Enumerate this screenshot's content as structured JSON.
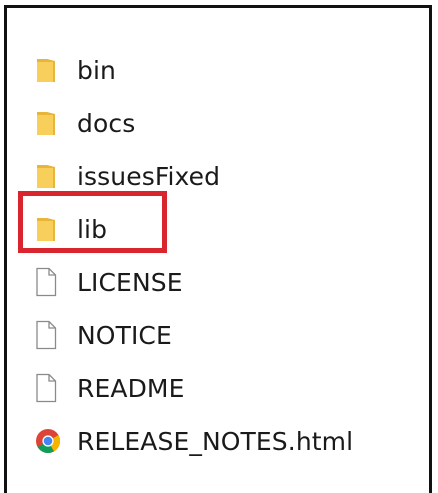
{
  "explorer": {
    "items": [
      {
        "label": "bin",
        "icon": "folder-icon",
        "kind": "folder"
      },
      {
        "label": "docs",
        "icon": "folder-icon",
        "kind": "folder"
      },
      {
        "label": "issuesFixed",
        "icon": "folder-icon",
        "kind": "folder"
      },
      {
        "label": "lib",
        "icon": "folder-icon",
        "kind": "folder",
        "highlighted": true
      },
      {
        "label": "LICENSE",
        "icon": "file-icon",
        "kind": "file"
      },
      {
        "label": "NOTICE",
        "icon": "file-icon",
        "kind": "file"
      },
      {
        "label": "README",
        "icon": "file-icon",
        "kind": "file"
      },
      {
        "label": "RELEASE_NOTES.html",
        "icon": "chrome-icon",
        "kind": "html"
      }
    ]
  },
  "colors": {
    "folder": "#f5c542",
    "highlight": "#d9262e",
    "frame": "#111111"
  }
}
